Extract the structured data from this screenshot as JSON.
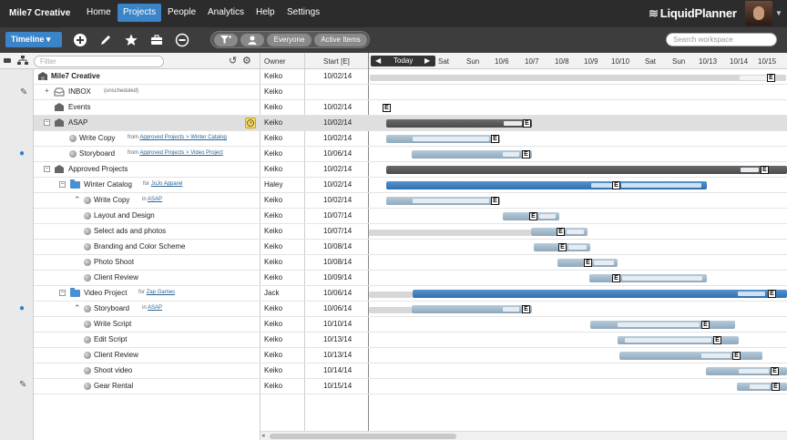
{
  "nav": {
    "workspace": "Mile7 Creative",
    "items": [
      {
        "label": "Home",
        "active": false
      },
      {
        "label": "Projects",
        "active": true
      },
      {
        "label": "People",
        "active": false
      },
      {
        "label": "Analytics",
        "active": false
      },
      {
        "label": "Help",
        "active": false
      },
      {
        "label": "Settings",
        "active": false
      }
    ],
    "logo": "LiquidPlanner",
    "logo_mark": "≋"
  },
  "toolbar": {
    "view": "Timeline ▾",
    "filters": {
      "everyone": "Everyone",
      "active": "Active Items"
    },
    "search_placeholder": "Search workspace"
  },
  "columns": {
    "filter_placeholder": "Filter",
    "owner": "Owner",
    "start": "Start [E]"
  },
  "timeline": {
    "today": "Today",
    "dates": [
      "Sat",
      "Sun",
      "10/6",
      "10/7",
      "10/8",
      "10/9",
      "10/10",
      "Sat",
      "Sun",
      "10/13",
      "10/14",
      "10/15"
    ]
  },
  "rows": [
    {
      "name": "Mile7 Creative",
      "bold": true,
      "owner": "Keiko",
      "start": "10/02/14"
    },
    {
      "name": "INBOX",
      "ctx": "(unscheduled)",
      "owner": "Keiko",
      "start": ""
    },
    {
      "name": "Events",
      "owner": "Keiko",
      "start": "10/02/14"
    },
    {
      "name": "ASAP",
      "owner": "Keiko",
      "start": "10/02/14"
    },
    {
      "name": "Write Copy",
      "ctx_prefix": "from",
      "ctx_link": "Approved Projects > Winter Catalog",
      "owner": "Keiko",
      "start": "10/02/14"
    },
    {
      "name": "Storyboard",
      "ctx_prefix": "from",
      "ctx_link": "Approved Projects > Video Project",
      "owner": "Keiko",
      "start": "10/06/14"
    },
    {
      "name": "Approved Projects",
      "owner": "Keiko",
      "start": "10/02/14"
    },
    {
      "name": "Winter Catalog",
      "ctx_prefix": "for",
      "ctx_link": "JoJo Apparel",
      "owner": "Haley",
      "start": "10/02/14"
    },
    {
      "name": "Write Copy",
      "ctx_prefix": "in",
      "ctx_link": "ASAP",
      "owner": "Keiko",
      "start": "10/02/14"
    },
    {
      "name": "Layout and Design",
      "owner": "Keiko",
      "start": "10/07/14"
    },
    {
      "name": "Select ads and photos",
      "owner": "Keiko",
      "start": "10/07/14"
    },
    {
      "name": "Branding and Color Scheme",
      "owner": "Keiko",
      "start": "10/08/14"
    },
    {
      "name": "Photo Shoot",
      "owner": "Keiko",
      "start": "10/08/14"
    },
    {
      "name": "Client Review",
      "owner": "Keiko",
      "start": "10/09/14"
    },
    {
      "name": "Video Project",
      "ctx_prefix": "for",
      "ctx_link": "Zap Games",
      "owner": "Jack",
      "start": "10/06/14"
    },
    {
      "name": "Storyboard",
      "ctx_prefix": "in",
      "ctx_link": "ASAP",
      "owner": "Keiko",
      "start": "10/06/14"
    },
    {
      "name": "Write Script",
      "owner": "Keiko",
      "start": "10/10/14"
    },
    {
      "name": "Edit Script",
      "owner": "Keiko",
      "start": "10/13/14"
    },
    {
      "name": "Client Review",
      "owner": "Keiko",
      "start": "10/13/14"
    },
    {
      "name": "Shoot video",
      "owner": "Keiko",
      "start": "10/14/14"
    },
    {
      "name": "Gear Rental",
      "owner": "Keiko",
      "start": "10/15/14"
    }
  ],
  "estimate_marker": "E"
}
